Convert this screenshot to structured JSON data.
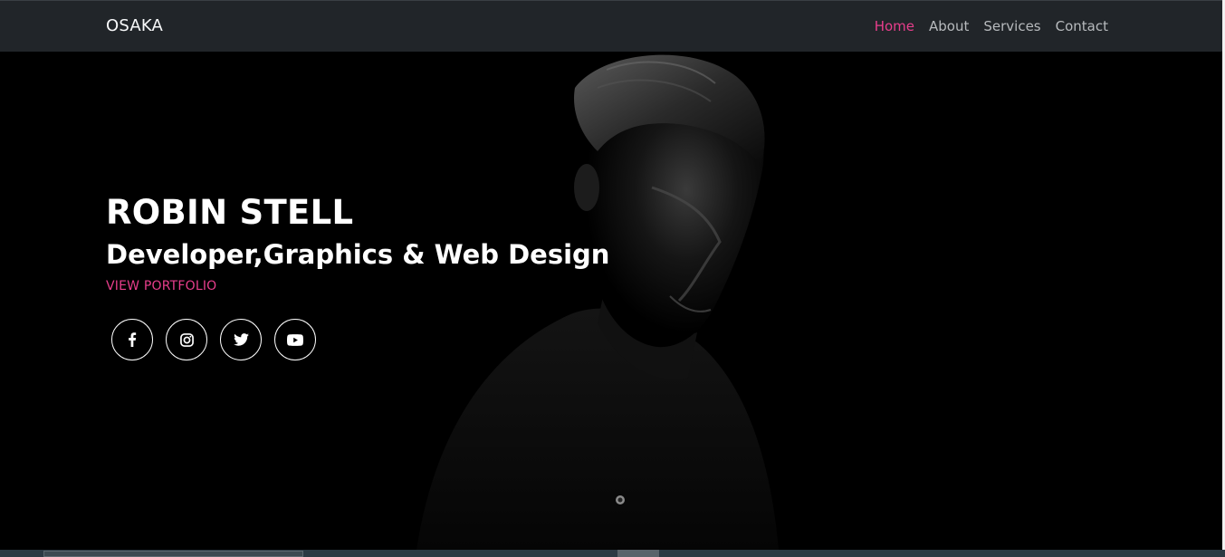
{
  "navbar": {
    "brand": "OSAKA",
    "links": [
      {
        "label": "Home",
        "active": true
      },
      {
        "label": "About",
        "active": false
      },
      {
        "label": "Services",
        "active": false
      },
      {
        "label": "Contact",
        "active": false
      }
    ]
  },
  "hero": {
    "name": "ROBIN STELL",
    "subtitle": "Developer,Graphics & Web Design",
    "cta_label": "VIEW PORTFOLIO"
  },
  "socials": [
    {
      "icon": "facebook-icon"
    },
    {
      "icon": "instagram-icon"
    },
    {
      "icon": "twitter-icon"
    },
    {
      "icon": "youtube-icon"
    }
  ],
  "colors": {
    "accent": "#e83e8c",
    "navbar_bg": "#212529",
    "hero_bg": "#000000",
    "nav_link": "#b7babd"
  }
}
